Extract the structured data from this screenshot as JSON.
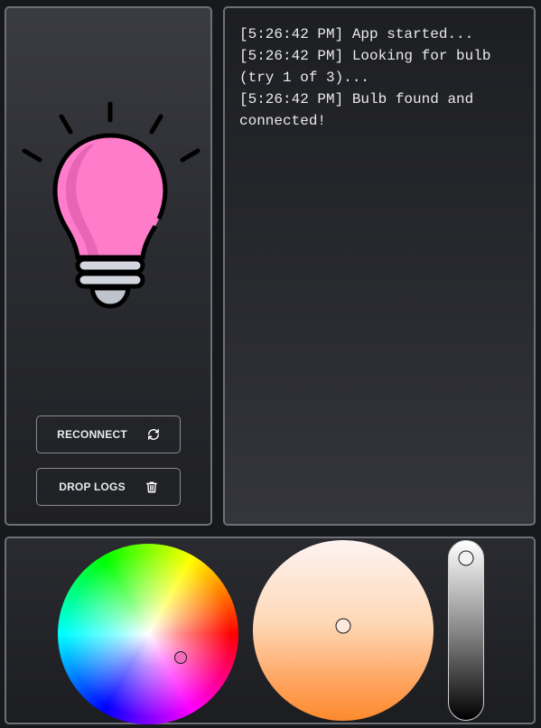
{
  "buttons": {
    "reconnect_label": "RECONNECT",
    "drop_logs_label": "DROP LOGS",
    "reconnect_icon": "refresh-icon",
    "drop_logs_icon": "trash-icon"
  },
  "logs": [
    "[5:26:42 PM] App started...",
    "[5:26:42 PM] Looking for bulb (try 1 of 3)...",
    "[5:26:42 PM] Bulb found and connected!"
  ],
  "bulb": {
    "icon": "lightbulb-icon",
    "color": "#fe7cc9"
  },
  "controls": {
    "color_wheel_selected": "#f26dc0",
    "temperature_selected": "#fde8dc",
    "brightness_level": 1.0
  }
}
